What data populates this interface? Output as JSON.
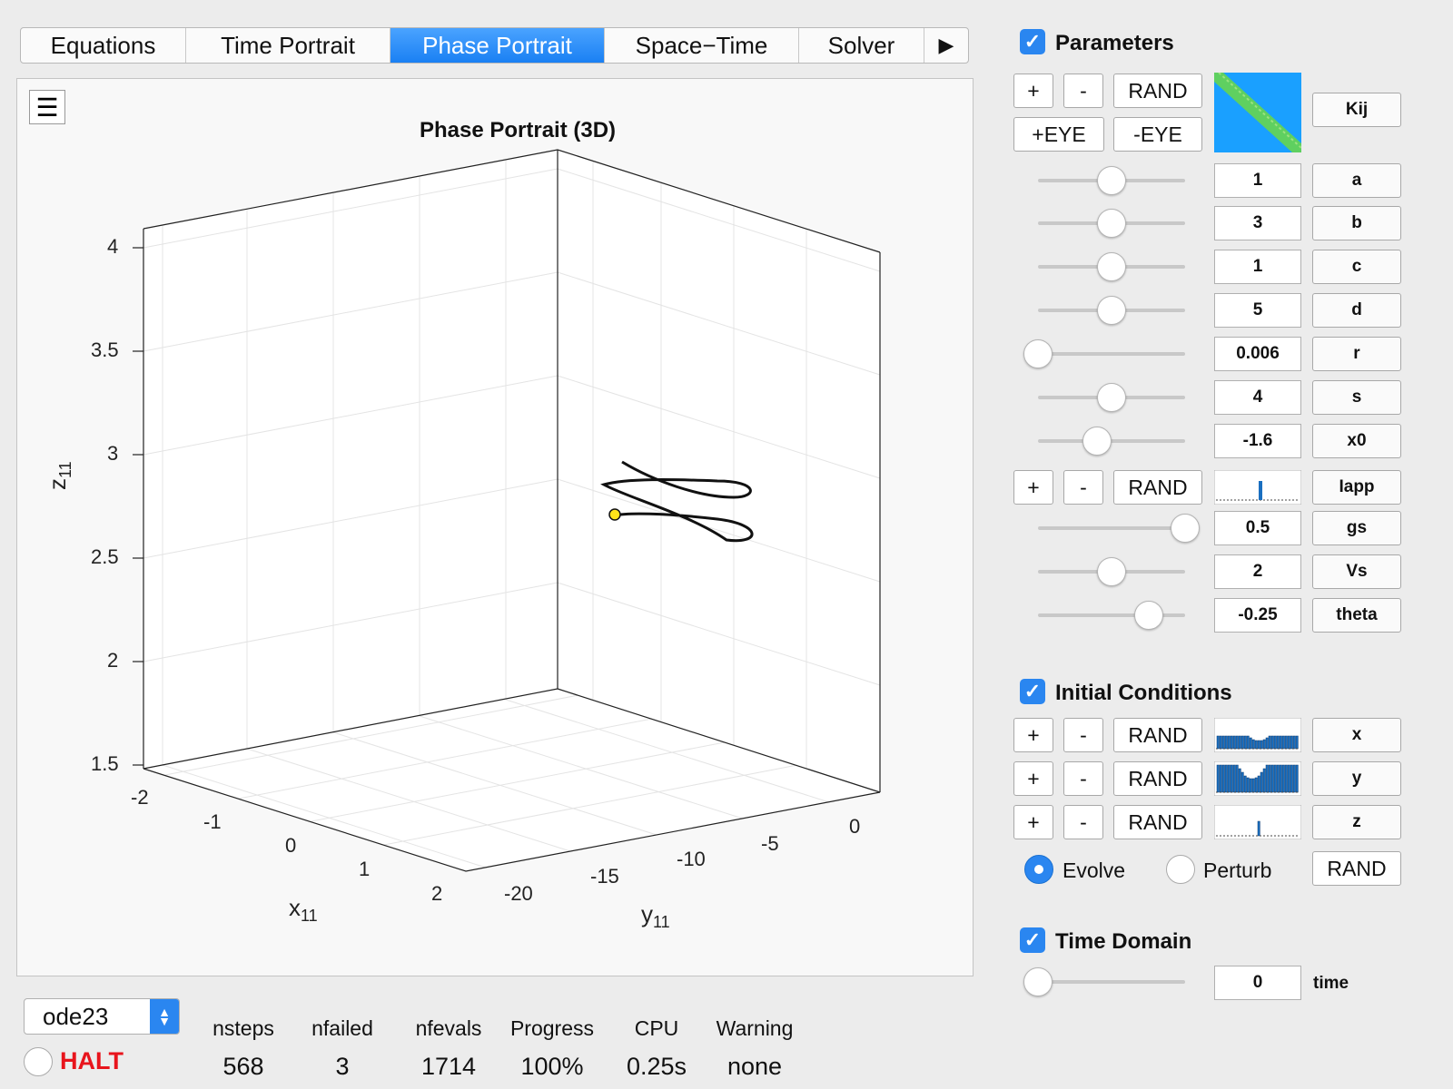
{
  "tabs": [
    "Equations",
    "Time Portrait",
    "Phase Portrait",
    "Space−Time",
    "Solver",
    "▶"
  ],
  "active_tab": "Phase Portrait",
  "plot": {
    "title": "Phase Portrait (3D)",
    "z_ticks": [
      "4",
      "3.5",
      "3",
      "2.5",
      "2",
      "1.5"
    ],
    "x_ticks": [
      "-2",
      "-1",
      "0",
      "1",
      "2"
    ],
    "y_ticks": [
      "-20",
      "-15",
      "-10",
      "-5",
      "0"
    ],
    "xlabel": "x",
    "xsub": "11",
    "ylabel": "y",
    "ysub": "11",
    "zlabel": "z",
    "zsub": "11"
  },
  "parameters": {
    "title": "Parameters",
    "checked": true,
    "buttons": {
      "plus": "+",
      "minus": "-",
      "rand": "RAND",
      "eye_plus": "+EYE",
      "eye_minus": "-EYE",
      "kij": "Kij"
    },
    "rows": [
      {
        "value": "1",
        "name": "a",
        "slider": 0.5
      },
      {
        "value": "3",
        "name": "b",
        "slider": 0.5
      },
      {
        "value": "1",
        "name": "c",
        "slider": 0.5
      },
      {
        "value": "5",
        "name": "d",
        "slider": 0.5
      },
      {
        "value": "0.006",
        "name": "r",
        "slider": 0.0
      },
      {
        "value": "4",
        "name": "s",
        "slider": 0.5
      },
      {
        "value": "-1.6",
        "name": "x0",
        "slider": 0.4
      },
      {
        "value": "0.5",
        "name": "gs",
        "slider": 1.0
      },
      {
        "value": "2",
        "name": "Vs",
        "slider": 0.5
      },
      {
        "value": "-0.25",
        "name": "theta",
        "slider": 0.75
      }
    ],
    "iapp_label": "Iapp"
  },
  "initial_conditions": {
    "title": "Initial Conditions",
    "checked": true,
    "rows": [
      {
        "name": "x"
      },
      {
        "name": "y"
      },
      {
        "name": "z"
      }
    ],
    "evolve": "Evolve",
    "perturb": "Perturb",
    "rand": "RAND",
    "mode": "Evolve"
  },
  "time_domain": {
    "title": "Time Domain",
    "checked": true,
    "value": "0",
    "label": "time",
    "slider": 0.0
  },
  "solver": {
    "selected": "ode23",
    "halt": "HALT",
    "stats": [
      {
        "head": "nsteps",
        "value": "568"
      },
      {
        "head": "nfailed",
        "value": "3"
      },
      {
        "head": "nfevals",
        "value": "1714"
      },
      {
        "head": "Progress",
        "value": "100%"
      },
      {
        "head": "CPU",
        "value": "0.25s"
      },
      {
        "head": "Warning",
        "value": "none"
      }
    ]
  },
  "colors": {
    "accent": "#2a86f0",
    "halt": "#e8141c",
    "matrix_bg": "#1aa0ff",
    "matrix_diag": "#5fd060",
    "marker": "#ffe41a"
  }
}
